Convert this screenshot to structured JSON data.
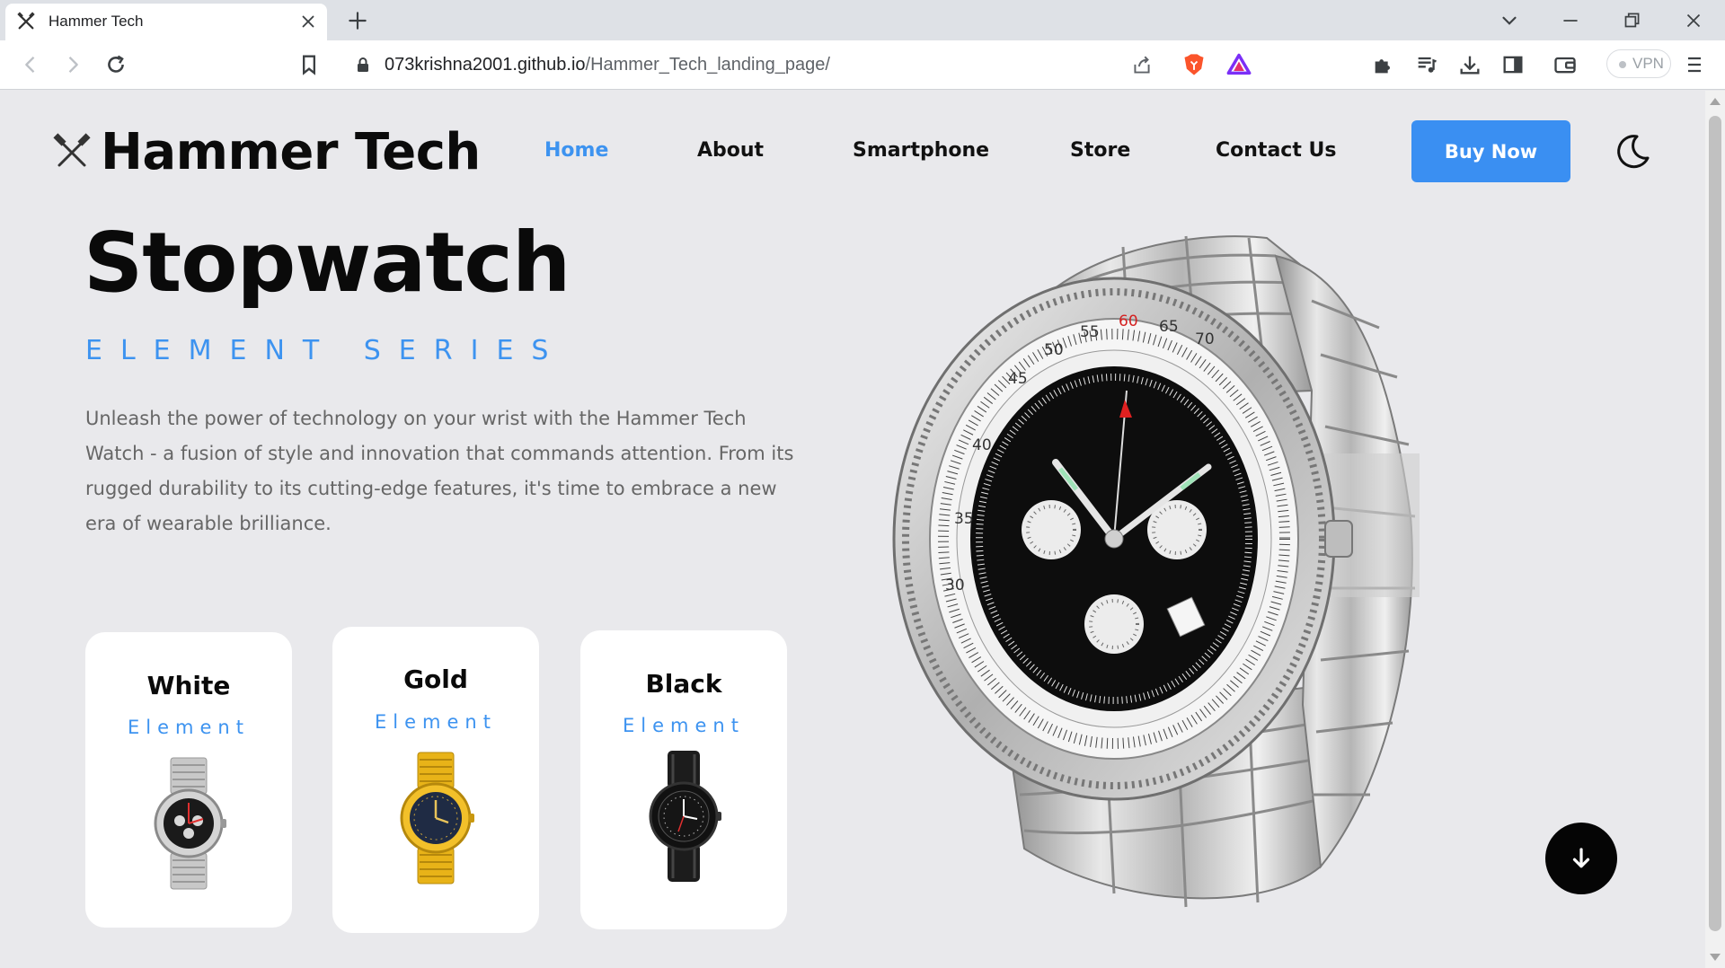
{
  "browser": {
    "tab_title": "Hammer Tech",
    "url_domain": "073krishna2001.github.io",
    "url_path": "/Hammer_Tech_landing_page/",
    "vpn_label": "VPN"
  },
  "site": {
    "brand": "Hammer Tech",
    "nav": [
      {
        "label": "Home",
        "active": true
      },
      {
        "label": "About",
        "active": false
      },
      {
        "label": "Smartphone",
        "active": false
      },
      {
        "label": "Store",
        "active": false
      },
      {
        "label": "Contact Us",
        "active": false
      }
    ],
    "buy_label": "Buy Now",
    "accent_color": "#3d93f0"
  },
  "hero": {
    "title": "Stopwatch",
    "series": "ELEMENT SERIES",
    "description": "Unleash the power of technology on your wrist with the Hammer Tech Watch - a fusion of style and innovation that commands attention. From its rugged durability to its cutting-edge features, it's time to embrace a new era of wearable brilliance."
  },
  "cards": [
    {
      "title": "White",
      "subtitle": "Element",
      "variant": "silver-watch"
    },
    {
      "title": "Gold",
      "subtitle": "Element",
      "variant": "gold-watch"
    },
    {
      "title": "Black",
      "subtitle": "Element",
      "variant": "black-watch"
    }
  ],
  "hero_watch_dial_numbers": [
    "60",
    "65",
    "70",
    "55",
    "50",
    "45",
    "40",
    "35",
    "30"
  ]
}
